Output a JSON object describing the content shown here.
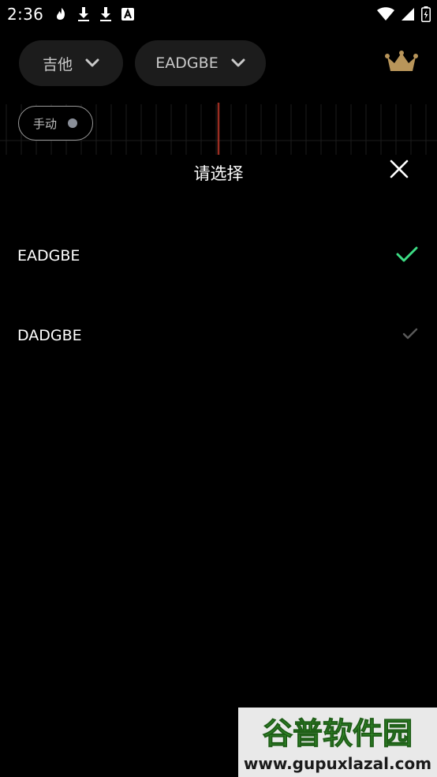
{
  "status_bar": {
    "time": "2:36",
    "left_icons": [
      "notification-icon",
      "download-icon",
      "download-icon",
      "app-icon"
    ],
    "right_icons": [
      "wifi-icon",
      "signal-icon",
      "battery-icon"
    ]
  },
  "selectors": {
    "instrument_label": "吉他",
    "tuning_label": "EADGBE"
  },
  "mode_toggle": {
    "label": "手动"
  },
  "sheet": {
    "title": "请选择",
    "options": [
      {
        "label": "EADGBE",
        "selected": true
      },
      {
        "label": "DADGBE",
        "selected": false
      }
    ]
  },
  "watermark": {
    "top": "谷普软件园",
    "bottom": "www.gupuxlazal.com"
  },
  "colors": {
    "background": "#000000",
    "chip_bg": "#1c1c1c",
    "check_selected": "#3ddc84",
    "check_unselected": "#5a5a5a",
    "crown": "#b8955a",
    "meter_needle": "#c0392b",
    "watermark_green": "#3a9a2e"
  }
}
